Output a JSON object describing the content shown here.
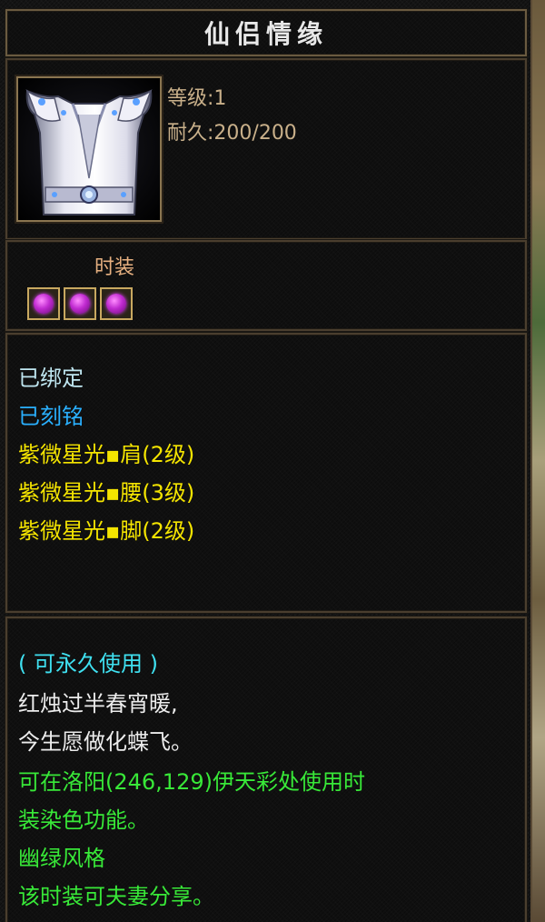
{
  "item": {
    "name": "仙侣情缘",
    "icon": "white-armor-costume-icon",
    "level": "等级:1",
    "durability": "耐久:200/200",
    "type": "时装",
    "gems": [
      "purple-gem-icon",
      "purple-gem-icon",
      "purple-gem-icon"
    ]
  },
  "properties": {
    "bound": "已绑定",
    "engraved": "已刻铭",
    "attributes": [
      "紫微星光▪肩(2级)",
      "紫微星光▪腰(3级)",
      "紫微星光▪脚(2级)"
    ]
  },
  "description": {
    "usage": "( 可永久使用 )",
    "poem": [
      "红烛过半春宵暖,",
      "今生愿做化蝶飞。"
    ],
    "notes": [
      "可在洛阳(246,129)伊天彩处使用时",
      "装染色功能。",
      "幽绿风格",
      "该时装可夫妻分享。"
    ]
  },
  "colors": {
    "title": "#e8e8e8",
    "stat": "#c9b08a",
    "type": "#e6b080",
    "bound": "#bfe6f0",
    "engraved": "#2ab0ff",
    "attribute": "#f4e400",
    "usage": "#3fe0f0",
    "poem": "#ececec",
    "note": "#38e838",
    "border": "#4a3e2e"
  }
}
